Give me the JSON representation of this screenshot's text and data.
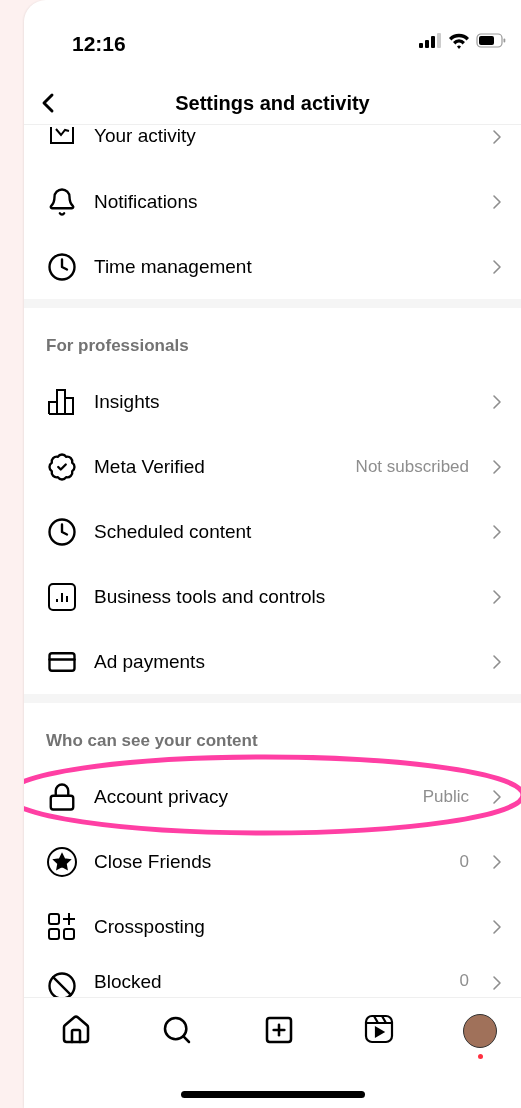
{
  "status_bar": {
    "time": "12:16"
  },
  "header": {
    "title": "Settings and activity"
  },
  "sections": [
    {
      "items": [
        {
          "label": "Your activity"
        },
        {
          "label": "Notifications"
        },
        {
          "label": "Time management"
        }
      ]
    },
    {
      "heading": "For professionals",
      "items": [
        {
          "label": "Insights"
        },
        {
          "label": "Meta Verified",
          "value": "Not subscribed"
        },
        {
          "label": "Scheduled content"
        },
        {
          "label": "Business tools and controls"
        },
        {
          "label": "Ad payments"
        }
      ]
    },
    {
      "heading": "Who can see your content",
      "items": [
        {
          "label": "Account privacy",
          "value": "Public",
          "highlighted": true
        },
        {
          "label": "Close Friends",
          "value": "0"
        },
        {
          "label": "Crossposting"
        },
        {
          "label": "Blocked",
          "value": "0"
        }
      ]
    }
  ],
  "tab_bar": {
    "profile_notification": true
  }
}
